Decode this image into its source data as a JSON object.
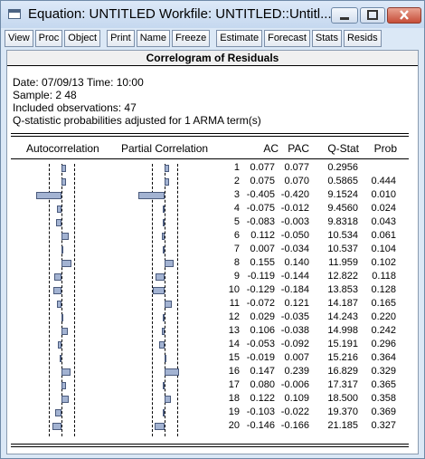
{
  "window": {
    "title": "Equation: UNTITLED   Workfile: UNTITLED::Untitl..."
  },
  "toolbar": {
    "buttons": [
      "View",
      "Proc",
      "Object",
      "Print",
      "Name",
      "Freeze",
      "Estimate",
      "Forecast",
      "Stats",
      "Resids"
    ]
  },
  "view": {
    "title": "Correlogram of Residuals",
    "header_lines": [
      "Date: 07/09/13   Time: 10:00",
      "Sample: 2 48",
      "Included observations: 47",
      "Q-statistic probabilities adjusted for 1 ARMA term(s)"
    ],
    "columns": {
      "autocorrelation": "Autocorrelation",
      "partial_correlation": "Partial Correlation",
      "lag": "",
      "ac": "AC",
      "pac": "PAC",
      "qstat": "Q-Stat",
      "prob": "Prob"
    },
    "rows": [
      {
        "lag": "1",
        "ac": "0.077",
        "pac": "0.077",
        "qstat": "0.2956",
        "prob": ""
      },
      {
        "lag": "2",
        "ac": "0.075",
        "pac": "0.070",
        "qstat": "0.5865",
        "prob": "0.444"
      },
      {
        "lag": "3",
        "ac": "-0.405",
        "pac": "-0.420",
        "qstat": "9.1524",
        "prob": "0.010"
      },
      {
        "lag": "4",
        "ac": "-0.075",
        "pac": "-0.012",
        "qstat": "9.4560",
        "prob": "0.024"
      },
      {
        "lag": "5",
        "ac": "-0.083",
        "pac": "-0.003",
        "qstat": "9.8318",
        "prob": "0.043"
      },
      {
        "lag": "6",
        "ac": "0.112",
        "pac": "-0.050",
        "qstat": "10.534",
        "prob": "0.061"
      },
      {
        "lag": "7",
        "ac": "0.007",
        "pac": "-0.034",
        "qstat": "10.537",
        "prob": "0.104"
      },
      {
        "lag": "8",
        "ac": "0.155",
        "pac": "0.140",
        "qstat": "11.959",
        "prob": "0.102"
      },
      {
        "lag": "9",
        "ac": "-0.119",
        "pac": "-0.144",
        "qstat": "12.822",
        "prob": "0.118"
      },
      {
        "lag": "10",
        "ac": "-0.129",
        "pac": "-0.184",
        "qstat": "13.853",
        "prob": "0.128"
      },
      {
        "lag": "11",
        "ac": "-0.072",
        "pac": "0.121",
        "qstat": "14.187",
        "prob": "0.165"
      },
      {
        "lag": "12",
        "ac": "0.029",
        "pac": "-0.035",
        "qstat": "14.243",
        "prob": "0.220"
      },
      {
        "lag": "13",
        "ac": "0.106",
        "pac": "-0.038",
        "qstat": "14.998",
        "prob": "0.242"
      },
      {
        "lag": "14",
        "ac": "-0.053",
        "pac": "-0.092",
        "qstat": "15.191",
        "prob": "0.296"
      },
      {
        "lag": "15",
        "ac": "-0.019",
        "pac": "0.007",
        "qstat": "15.216",
        "prob": "0.364"
      },
      {
        "lag": "16",
        "ac": "0.147",
        "pac": "0.239",
        "qstat": "16.829",
        "prob": "0.329"
      },
      {
        "lag": "17",
        "ac": "0.080",
        "pac": "-0.006",
        "qstat": "17.317",
        "prob": "0.365"
      },
      {
        "lag": "18",
        "ac": "0.122",
        "pac": "0.109",
        "qstat": "18.500",
        "prob": "0.358"
      },
      {
        "lag": "19",
        "ac": "-0.103",
        "pac": "-0.022",
        "qstat": "19.370",
        "prob": "0.369"
      },
      {
        "lag": "20",
        "ac": "-0.146",
        "pac": "-0.166",
        "qstat": "21.185",
        "prob": "0.327"
      }
    ]
  },
  "colors": {
    "bar_fill": "#a3b3d2",
    "bar_border": "#4a5a7c",
    "title_bar": "#c5d8ef",
    "close_button": "#c64d38"
  }
}
